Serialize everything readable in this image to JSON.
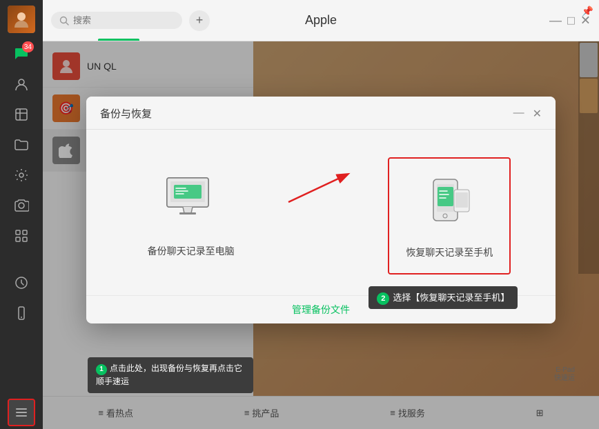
{
  "app": {
    "title": "Apple",
    "search_placeholder": "搜索"
  },
  "window_controls": {
    "pin": "📌",
    "minimize": "—",
    "restore": "□",
    "close": "✕"
  },
  "sidebar": {
    "badge_count": "34",
    "icons": [
      "chat",
      "contacts",
      "box",
      "folder",
      "settings",
      "camera",
      "apps",
      "clock",
      "mobile"
    ]
  },
  "dialog": {
    "title": "备份与恢复",
    "close_btn": "✕",
    "minimize_btn": "—",
    "option1": {
      "label": "备份聊天记录至电脑",
      "icon_type": "desktop"
    },
    "option2": {
      "label": "恢复聊天记录至手机",
      "icon_type": "mobile",
      "highlighted": true
    },
    "manage_link": "管理备份文件",
    "tooltip2_badge": "2",
    "tooltip2_text": "选择【恢复聊天记录至手机】"
  },
  "tooltip1": {
    "badge": "1",
    "text": "点击此处，出现备份与恢复再点击它顺手速运"
  },
  "bottom_nav": {
    "items": [
      "看热点",
      "挑产品",
      "找服务"
    ]
  },
  "bottom_nav_icon": "⊞"
}
